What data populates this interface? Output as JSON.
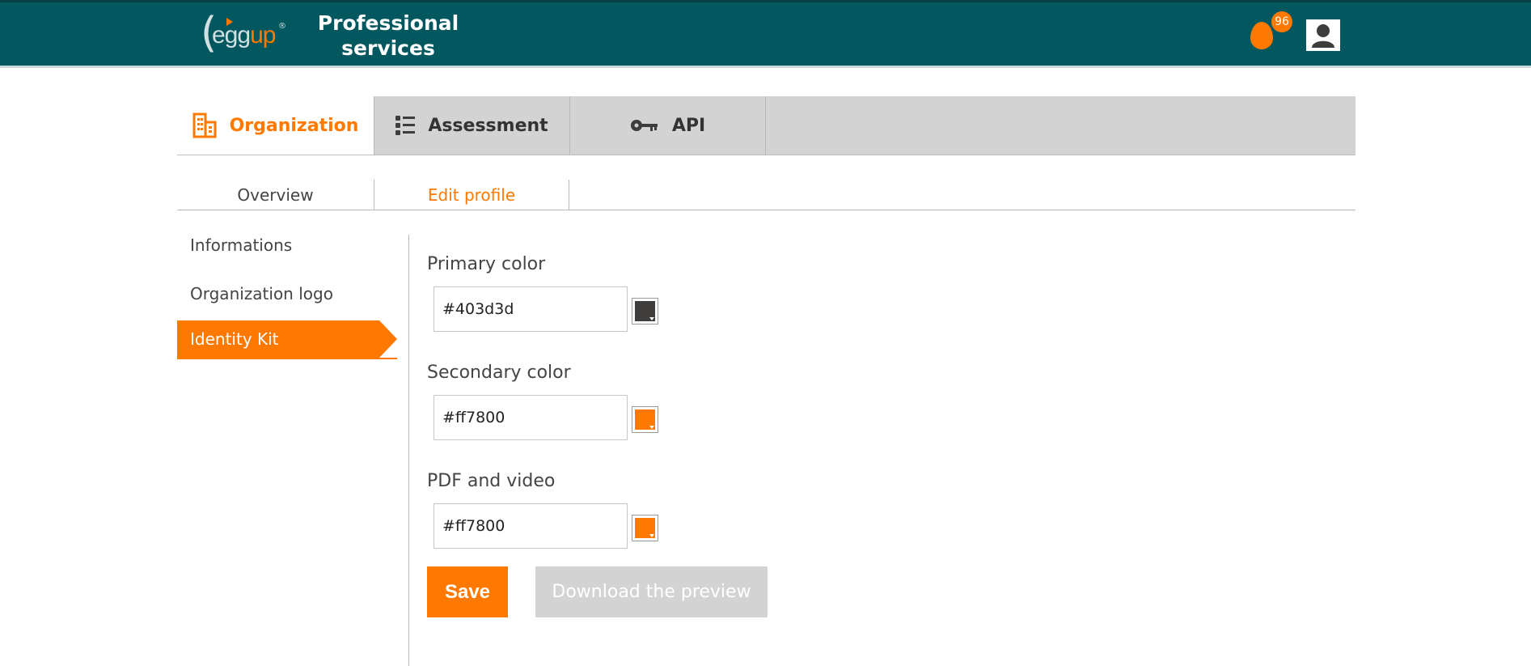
{
  "header": {
    "logo_prefix": "egg",
    "logo_suffix": "up",
    "logo_registered": "®",
    "title": "Professional\nservices",
    "notification_icon": "egg-icon",
    "notification_count": "96",
    "avatar_icon": "user-avatar-icon",
    "colors": {
      "background": "#03575e",
      "accent": "#ff7800"
    }
  },
  "main_tabs": [
    {
      "label": "Organization",
      "icon": "building-icon",
      "active": true
    },
    {
      "label": "Assessment",
      "icon": "list-icon",
      "active": false
    },
    {
      "label": "API",
      "icon": "key-icon",
      "active": false
    }
  ],
  "sub_tabs": [
    {
      "label": "Overview",
      "active": false
    },
    {
      "label": "Edit profile",
      "active": true
    }
  ],
  "side_nav": [
    {
      "label": "Informations",
      "active": false
    },
    {
      "label": "Organization logo",
      "active": false
    },
    {
      "label": "Identity Kit",
      "active": true
    }
  ],
  "form": {
    "primary": {
      "label": "Primary color",
      "value": "#403d3d"
    },
    "secondary": {
      "label": "Secondary color",
      "value": "#ff7800"
    },
    "pdf_video": {
      "label": "PDF and video",
      "value": "#ff7800"
    }
  },
  "buttons": {
    "save": "Save",
    "download_preview": "Download the preview"
  }
}
